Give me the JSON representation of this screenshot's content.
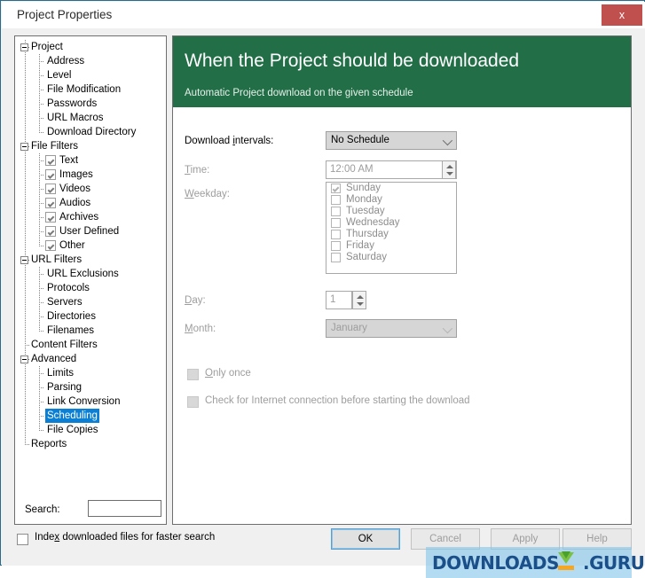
{
  "window": {
    "title": "Project Properties",
    "close_label": "x",
    "close_icon": "close-icon",
    "border_color": "#2c6a8a"
  },
  "tree": {
    "selected": "Scheduling",
    "selection_color": "#0a7fd4",
    "items": [
      {
        "label": "Project",
        "depth": 0,
        "expander": "minus"
      },
      {
        "label": "Address",
        "depth": 1
      },
      {
        "label": "Level",
        "depth": 1
      },
      {
        "label": "File Modification",
        "depth": 1
      },
      {
        "label": "Passwords",
        "depth": 1
      },
      {
        "label": "URL Macros",
        "depth": 1
      },
      {
        "label": "Download Directory",
        "depth": 1,
        "last": true
      },
      {
        "label": "File Filters",
        "depth": 0,
        "expander": "minus"
      },
      {
        "label": "Text",
        "depth": 1,
        "checkbox": true,
        "checked": true
      },
      {
        "label": "Images",
        "depth": 1,
        "checkbox": true,
        "checked": true
      },
      {
        "label": "Videos",
        "depth": 1,
        "checkbox": true,
        "checked": true
      },
      {
        "label": "Audios",
        "depth": 1,
        "checkbox": true,
        "checked": true
      },
      {
        "label": "Archives",
        "depth": 1,
        "checkbox": true,
        "checked": true
      },
      {
        "label": "User Defined",
        "depth": 1,
        "checkbox": true,
        "checked": true
      },
      {
        "label": "Other",
        "depth": 1,
        "checkbox": true,
        "checked": true,
        "last": true
      },
      {
        "label": "URL Filters",
        "depth": 0,
        "expander": "minus"
      },
      {
        "label": "URL Exclusions",
        "depth": 1
      },
      {
        "label": "Protocols",
        "depth": 1
      },
      {
        "label": "Servers",
        "depth": 1
      },
      {
        "label": "Directories",
        "depth": 1
      },
      {
        "label": "Filenames",
        "depth": 1,
        "last": true
      },
      {
        "label": "Content Filters",
        "depth": 0
      },
      {
        "label": "Advanced",
        "depth": 0,
        "expander": "minus"
      },
      {
        "label": "Limits",
        "depth": 1
      },
      {
        "label": "Parsing",
        "depth": 1
      },
      {
        "label": "Link Conversion",
        "depth": 1
      },
      {
        "label": "Scheduling",
        "depth": 1,
        "selected": true
      },
      {
        "label": "File Copies",
        "depth": 1,
        "last": true
      },
      {
        "label": "Reports",
        "depth": 0,
        "last": true
      }
    ],
    "search": {
      "label": "Search:",
      "value": "",
      "placeholder": ""
    }
  },
  "pane": {
    "header": {
      "title": "When the Project should be downloaded",
      "subtitle": "Automatic Project download on the given schedule",
      "background": "#216e47"
    },
    "fields": {
      "download_intervals": {
        "label_pre": "Download ",
        "label_acc": "i",
        "label_post": "ntervals:",
        "value": "No Schedule",
        "enabled": true,
        "chevron_icon": "chevron-down-icon"
      },
      "time": {
        "label_acc": "T",
        "label_post": "ime:",
        "value": "12:00 AM",
        "enabled": false,
        "spinner_up_icon": "arrow-up-icon",
        "spinner_down_icon": "arrow-down-icon"
      },
      "weekday": {
        "label_acc": "W",
        "label_post": "eekday:",
        "enabled": false,
        "options": [
          {
            "label": "Sunday",
            "checked": true
          },
          {
            "label": "Monday",
            "checked": false
          },
          {
            "label": "Tuesday",
            "checked": false
          },
          {
            "label": "Wednesday",
            "checked": false
          },
          {
            "label": "Thursday",
            "checked": false
          },
          {
            "label": "Friday",
            "checked": false
          },
          {
            "label": "Saturday",
            "checked": false
          }
        ]
      },
      "day": {
        "label_acc": "D",
        "label_post": "ay:",
        "value": "1",
        "enabled": false,
        "spinner_up_icon": "arrow-up-icon",
        "spinner_down_icon": "arrow-down-icon"
      },
      "month": {
        "label_acc": "M",
        "label_post": "onth:",
        "value": "January",
        "enabled": false,
        "chevron_icon": "chevron-down-icon"
      },
      "only_once": {
        "label_acc": "O",
        "label_post": "nly once",
        "checked": false,
        "enabled": false
      },
      "check_internet": {
        "label": "Check for Internet connection before starting the download",
        "checked": false,
        "enabled": false
      }
    }
  },
  "footer": {
    "index_checkbox": {
      "label_pre": "Inde",
      "label_acc": "x",
      "label_post": " downloaded files for faster search",
      "checked": false
    },
    "buttons": [
      {
        "label": "OK",
        "name": "ok-button",
        "default": true,
        "enabled": true
      },
      {
        "label": "Cancel",
        "name": "cancel-button",
        "default": false,
        "enabled": false
      },
      {
        "label": "Apply",
        "name": "apply-button",
        "default": false,
        "enabled": false
      },
      {
        "label": "Help",
        "name": "help-button",
        "default": false,
        "enabled": false
      }
    ]
  },
  "watermark": {
    "text_left": "DOWNLOADS",
    "text_right": ".GURU",
    "logo_icon": "download-arrow-icon",
    "text_color": "#1a4f8a",
    "band_color": "#85c7eb"
  }
}
